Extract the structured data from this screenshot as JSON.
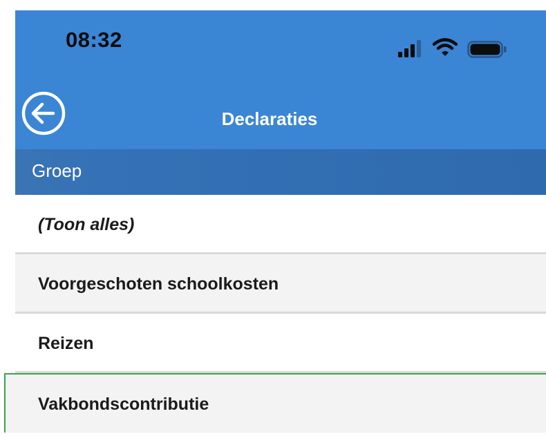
{
  "status_bar": {
    "time": "08:32",
    "icons": [
      "signal-icon",
      "wifi-icon",
      "battery-icon"
    ]
  },
  "nav": {
    "title": "Declaraties",
    "back_icon": "back-arrow-circle-icon"
  },
  "section": {
    "label": "Groep"
  },
  "items": [
    {
      "label": "(Toon alles)"
    },
    {
      "label": "Voorgeschoten schoolkosten"
    },
    {
      "label": "Reizen"
    },
    {
      "label": "Vakbondscontributie"
    }
  ],
  "colors": {
    "header_blue": "#3b85d5",
    "section_blue": "#3471b6",
    "selection_green": "#3aa34a",
    "row_alt": "#f3f3f3"
  }
}
